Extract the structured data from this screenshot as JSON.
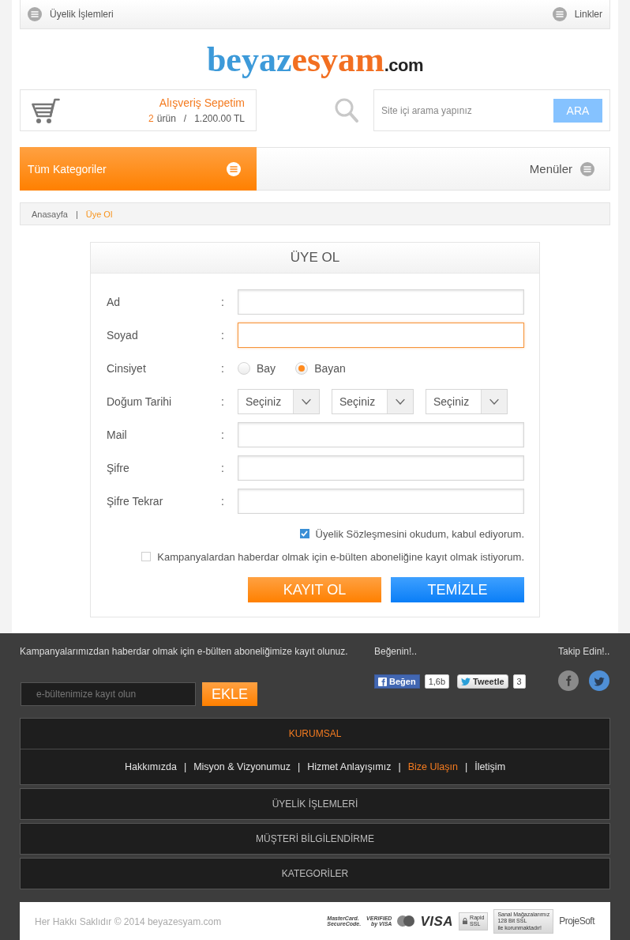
{
  "top_bar": {
    "left_link": "Üyelik İşlemleri",
    "right_link": "Linkler"
  },
  "logo": {
    "parts": [
      {
        "text": "beyaz",
        "color": "#3d9ad9"
      },
      {
        "text": "esyam",
        "color": "#f26f21"
      },
      {
        "text": ".com",
        "color": "#222222"
      }
    ]
  },
  "cart": {
    "title": "Alışveriş Sepetim",
    "count": "2",
    "count_label": "ürün",
    "separator": "/",
    "total": "1.200.00 TL"
  },
  "search": {
    "placeholder": "Site içi arama yapınız",
    "button": "ARA"
  },
  "nav": {
    "categories": "Tüm Kategoriler",
    "menus": "Menüler"
  },
  "breadcrumb": {
    "items": [
      {
        "label": "Anasayfa",
        "current": false
      },
      {
        "label": "Üye Ol",
        "current": true
      }
    ],
    "separators": [
      "|"
    ]
  },
  "form": {
    "title": "ÜYE OL",
    "fields": [
      {
        "kind": "text",
        "label": "Ad",
        "separator": ":",
        "focused": false
      },
      {
        "kind": "text",
        "label": "Soyad",
        "separator": ":",
        "focused": true
      },
      {
        "kind": "radio",
        "label": "Cinsiyet",
        "separator": ":",
        "options": [
          {
            "label": "Bay",
            "selected": false
          },
          {
            "label": "Bayan",
            "selected": true
          }
        ]
      },
      {
        "kind": "date",
        "label": "Doğum Tarihi",
        "separator": ":",
        "selects": [
          "Seçiniz",
          "Seçiniz",
          "Seçiniz"
        ]
      },
      {
        "kind": "text",
        "label": "Mail",
        "separator": ":",
        "focused": false
      },
      {
        "kind": "text",
        "label": "Şifre",
        "separator": ":",
        "focused": false
      },
      {
        "kind": "text",
        "label": "Şifre Tekrar",
        "separator": ":",
        "focused": false
      }
    ],
    "checkboxes": [
      {
        "label": "Üyelik Sözleşmesini okudum, kabul ediyorum.",
        "checked": true
      },
      {
        "label": "Kampanyalardan haberdar olmak için e-bülten aboneliğine kayıt olmak istiyorum.",
        "checked": false
      }
    ],
    "buttons": [
      {
        "kind": "submit",
        "label": "KAYIT OL"
      },
      {
        "kind": "reset",
        "label": "TEMİZLE"
      }
    ]
  },
  "footer": {
    "newsletter": {
      "text": "Kampanyalarımızdan haberdar olmak için e-bülten aboneliğimize kayıt olunuz.",
      "placeholder": "e-bültenimize kayıt olun",
      "button": "EKLE"
    },
    "like": {
      "title": "Beğenin!..",
      "widgets": [
        {
          "kind": "facebook",
          "label": "Beğen",
          "count": "1,6b"
        },
        {
          "kind": "twitter",
          "label": "Tweetle",
          "count": "3"
        }
      ]
    },
    "follow": {
      "title": "Takip Edin!.."
    },
    "sections": [
      {
        "title": "KURUMSAL",
        "expanded": true,
        "links": [
          {
            "label": "Hakkımızda",
            "selected": false
          },
          {
            "separator": "|",
            "label": "Misyon & Vizyonumuz",
            "selected": false
          },
          {
            "separator": "|",
            "label": "Hizmet Anlayışımız",
            "selected": false
          },
          {
            "separator": "|",
            "label": "Bize Ulaşın",
            "selected": true
          },
          {
            "separator": "|",
            "label": "İletişim",
            "selected": false
          }
        ]
      },
      {
        "title": "ÜYELİK İŞLEMLERİ",
        "expanded": false
      },
      {
        "title": "MÜŞTERİ BİLGİLENDİRME",
        "expanded": false
      },
      {
        "title": "KATEGORİLER",
        "expanded": false
      }
    ],
    "bottom": {
      "copyright": "Her Hakkı Saklıdır © 2014 beyazesyam.com",
      "badges": [
        {
          "kind": "securecode",
          "lines": [
            "MasterCard.",
            "SecureCode."
          ]
        },
        {
          "kind": "verified",
          "lines": [
            "VERIFIED",
            "by VISA"
          ]
        },
        {
          "kind": "mastercard"
        },
        {
          "kind": "visa",
          "lines": [
            "VISA"
          ]
        },
        {
          "kind": "rapidssl",
          "lines": [
            "Rapid",
            "SSL"
          ]
        },
        {
          "kind": "ssl",
          "lines": [
            "Sanal Mağazalarımız",
            "128 Bit SSL",
            "ile korunmaktadır!"
          ]
        },
        {
          "kind": "projesoft",
          "lines": [
            "ProjeSoft"
          ]
        }
      ]
    }
  }
}
